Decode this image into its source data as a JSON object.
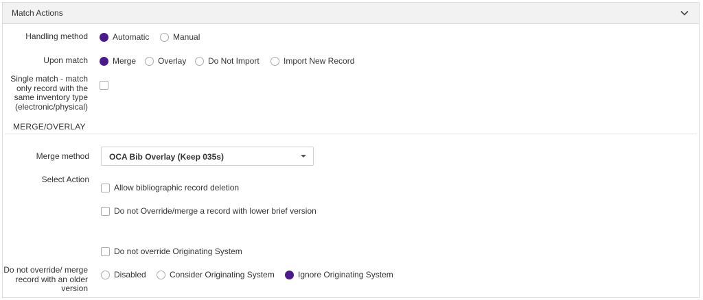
{
  "panel": {
    "title": "Match Actions",
    "collapse_icon": "chevron-down-icon"
  },
  "handling": {
    "label": "Handling method",
    "options": [
      {
        "label": "Automatic",
        "selected": true
      },
      {
        "label": "Manual",
        "selected": false
      }
    ]
  },
  "upon_match": {
    "label": "Upon match",
    "options": [
      {
        "label": "Merge",
        "selected": true
      },
      {
        "label": "Overlay",
        "selected": false
      },
      {
        "label": "Do Not Import",
        "selected": false
      },
      {
        "label": "Import New Record",
        "selected": false
      }
    ]
  },
  "single_match": {
    "label": "Single match - match only record with the same inventory type (electronic/physical)",
    "checked": false
  },
  "merge_overlay": {
    "heading": "MERGE/OVERLAY",
    "merge_method": {
      "label": "Merge method",
      "value": "OCA Bib Overlay (Keep 035s)"
    },
    "select_action": {
      "label": "Select Action",
      "options": [
        {
          "label": "Allow bibliographic record deletion",
          "checked": false
        },
        {
          "label": "Do not Override/merge a record with lower brief version",
          "checked": false
        }
      ]
    },
    "originating_system": {
      "label": "Do not override Originating System",
      "checked": false
    },
    "older_version": {
      "label": "Do not override/ merge record with an older version",
      "options": [
        {
          "label": "Disabled",
          "selected": false
        },
        {
          "label": "Consider Originating System",
          "selected": false
        },
        {
          "label": "Ignore Originating System",
          "selected": true
        }
      ]
    }
  },
  "colors": {
    "accent": "#4a1a8c",
    "header_bg": "#f2f2f2",
    "border": "#dcdcdc"
  }
}
